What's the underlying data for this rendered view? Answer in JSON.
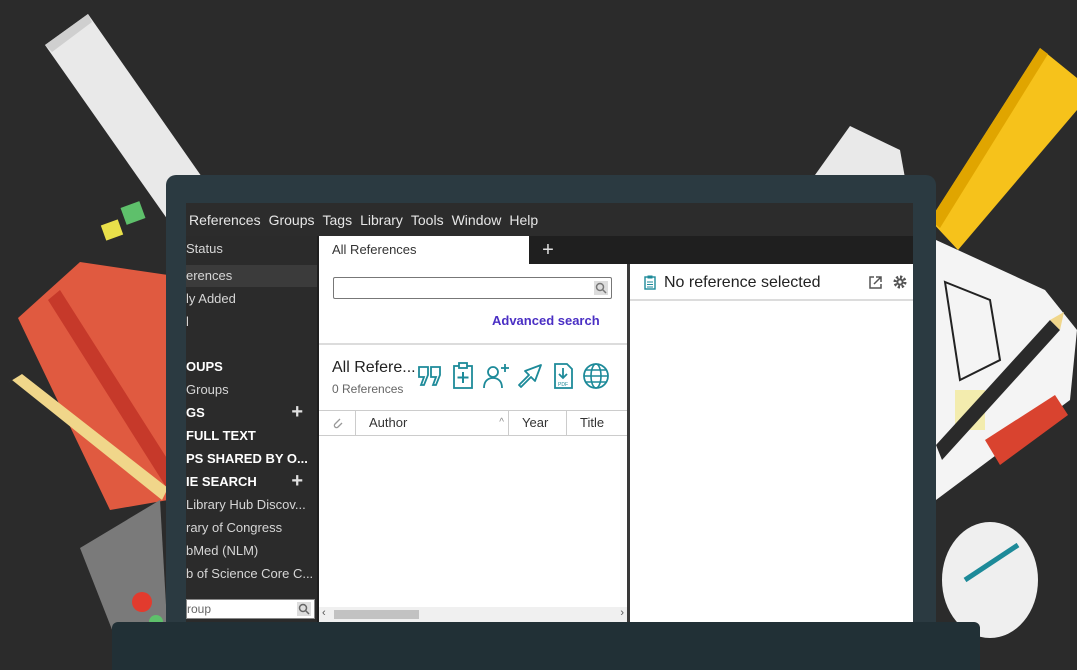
{
  "menu": [
    "References",
    "Groups",
    "Tags",
    "Library",
    "Tools",
    "Window",
    "Help"
  ],
  "sidebar": {
    "items": [
      {
        "label": "Status",
        "kind": "item"
      },
      {
        "label": "erences",
        "kind": "item",
        "selected": true
      },
      {
        "label": "ly Added",
        "kind": "item"
      },
      {
        "label": "l",
        "kind": "item"
      },
      {
        "label": "OUPS",
        "kind": "header"
      },
      {
        "label": "Groups",
        "kind": "item"
      },
      {
        "label": "GS",
        "kind": "header",
        "plus": "+"
      },
      {
        "label": "FULL TEXT",
        "kind": "header"
      },
      {
        "label": "PS SHARED BY O...",
        "kind": "header"
      },
      {
        "label": "IE SEARCH",
        "kind": "header",
        "plus": "+"
      },
      {
        "label": "Library Hub Discov...",
        "kind": "item"
      },
      {
        "label": "rary of Congress",
        "kind": "item"
      },
      {
        "label": "bMed (NLM)",
        "kind": "item"
      },
      {
        "label": "b of Science Core C...",
        "kind": "item"
      }
    ],
    "search_placeholder": "roup"
  },
  "tabs": {
    "active": "All References",
    "add": "+"
  },
  "center": {
    "advanced_search": "Advanced search",
    "library_title": "All Refere...",
    "library_count": "0 References",
    "toolbar_icons": [
      "quote-icon",
      "clipboard-add-icon",
      "add-user-icon",
      "share-arrow-icon",
      "pdf-download-icon",
      "globe-icon"
    ],
    "columns": [
      "Author",
      "Year",
      "Title"
    ]
  },
  "right": {
    "title": "No reference selected"
  },
  "colors": {
    "accent_teal": "#1d8a99",
    "link_purple": "#4a2fc4"
  }
}
